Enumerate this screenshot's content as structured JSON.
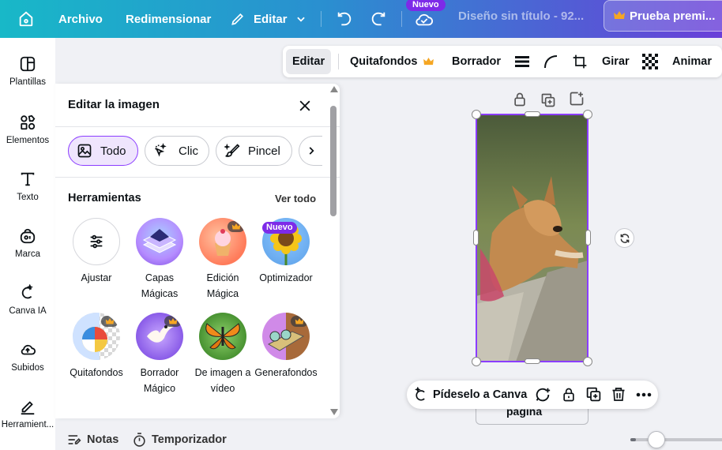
{
  "colors": {
    "accent": "#7d2ae8",
    "topbar_start": "#18b8c8",
    "topbar_end": "#6a3fd8",
    "selection": "#8b3dff",
    "crown": "#f5a623"
  },
  "topbar": {
    "archivo": "Archivo",
    "redimensionar": "Redimensionar",
    "editar": "Editar",
    "nuevo_badge": "Nuevo",
    "doc_title": "Diseño sin título - 92...",
    "trial_button": "Prueba premi..."
  },
  "sidebar": {
    "items": [
      {
        "label": "Plantillas",
        "icon": "templates-icon"
      },
      {
        "label": "Elementos",
        "icon": "elements-icon"
      },
      {
        "label": "Texto",
        "icon": "text-icon"
      },
      {
        "label": "Marca",
        "icon": "brand-icon"
      },
      {
        "label": "Canva IA",
        "icon": "canva-ai-icon"
      },
      {
        "label": "Subidos",
        "icon": "upload-icon"
      },
      {
        "label": "Herramient...",
        "icon": "tools-icon"
      }
    ]
  },
  "context_bar": {
    "editar": "Editar",
    "quitafondos": "Quitafondos",
    "borrador": "Borrador",
    "girar": "Girar",
    "animar": "Animar"
  },
  "panel": {
    "title": "Editar la imagen",
    "chips": [
      "Todo",
      "Clic",
      "Pincel"
    ],
    "section_title": "Herramientas",
    "see_all": "Ver todo",
    "tools": [
      {
        "label": "Ajustar",
        "icon": "sliders-icon"
      },
      {
        "label": "Capas Mágicas",
        "icon": "magic-layers-icon"
      },
      {
        "label": "Edición Mágica",
        "icon": "magic-edit-icon"
      },
      {
        "label": "Optimizador",
        "icon": "enhancer-icon",
        "badge": "Nuevo"
      },
      {
        "label": "Quitafondos",
        "icon": "bg-remover-icon"
      },
      {
        "label": "Borrador Mágico",
        "icon": "magic-eraser-icon"
      },
      {
        "label": "De imagen a vídeo",
        "icon": "image-to-video-icon"
      },
      {
        "label": "Generafondos",
        "icon": "bg-generator-icon"
      }
    ]
  },
  "floating_bar": {
    "ask_canva": "Pídeselo a Canva"
  },
  "page_label": "página",
  "bottom_bar": {
    "notas": "Notas",
    "temporizador": "Temporizador",
    "zoom_level": 0.06
  }
}
